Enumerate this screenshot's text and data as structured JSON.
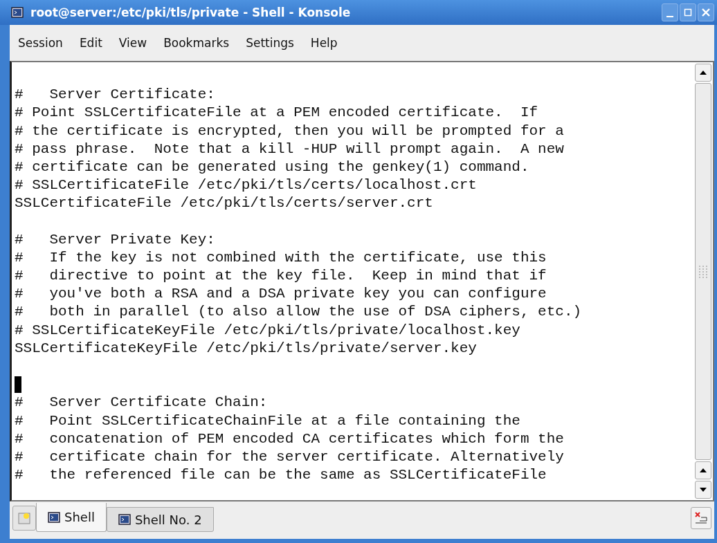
{
  "window": {
    "title": "root@server:/etc/pki/tls/private - Shell - Konsole"
  },
  "menu": [
    "Session",
    "Edit",
    "View",
    "Bookmarks",
    "Settings",
    "Help"
  ],
  "terminal": {
    "lines": [
      {
        "kind": "blank"
      },
      {
        "kind": "text",
        "text": "#   Server Certificate:"
      },
      {
        "kind": "text",
        "text": "# Point SSLCertificateFile at a PEM encoded certificate.  If"
      },
      {
        "kind": "text",
        "text": "# the certificate is encrypted, then you will be prompted for a"
      },
      {
        "kind": "text",
        "text": "# pass phrase.  Note that a kill -HUP will prompt again.  A new"
      },
      {
        "kind": "text",
        "text": "# certificate can be generated using the genkey(1) command."
      },
      {
        "kind": "text",
        "text": "# SSLCertificateFile /etc/pki/tls/certs/localhost.crt"
      },
      {
        "kind": "text",
        "text": "SSLCertificateFile /etc/pki/tls/certs/server.crt"
      },
      {
        "kind": "blank"
      },
      {
        "kind": "text",
        "text": "#   Server Private Key:"
      },
      {
        "kind": "text",
        "text": "#   If the key is not combined with the certificate, use this"
      },
      {
        "kind": "text",
        "text": "#   directive to point at the key file.  Keep in mind that if"
      },
      {
        "kind": "text",
        "text": "#   you've both a RSA and a DSA private key you can configure"
      },
      {
        "kind": "text",
        "text": "#   both in parallel (to also allow the use of DSA ciphers, etc.)"
      },
      {
        "kind": "text",
        "text": "# SSLCertificateKeyFile /etc/pki/tls/private/localhost.key"
      },
      {
        "kind": "text",
        "text": "SSLCertificateKeyFile /etc/pki/tls/private/server.key"
      },
      {
        "kind": "blank"
      },
      {
        "kind": "cursor"
      },
      {
        "kind": "text",
        "text": "#   Server Certificate Chain:"
      },
      {
        "kind": "text",
        "text": "#   Point SSLCertificateChainFile at a file containing the"
      },
      {
        "kind": "text",
        "text": "#   concatenation of PEM encoded CA certificates which form the"
      },
      {
        "kind": "text",
        "text": "#   certificate chain for the server certificate. Alternatively"
      },
      {
        "kind": "text",
        "text": "#   the referenced file can be the same as SSLCertificateFile"
      }
    ]
  },
  "tabs": [
    {
      "label": "Shell",
      "selected": true
    },
    {
      "label": "Shell No. 2",
      "selected": false
    }
  ]
}
